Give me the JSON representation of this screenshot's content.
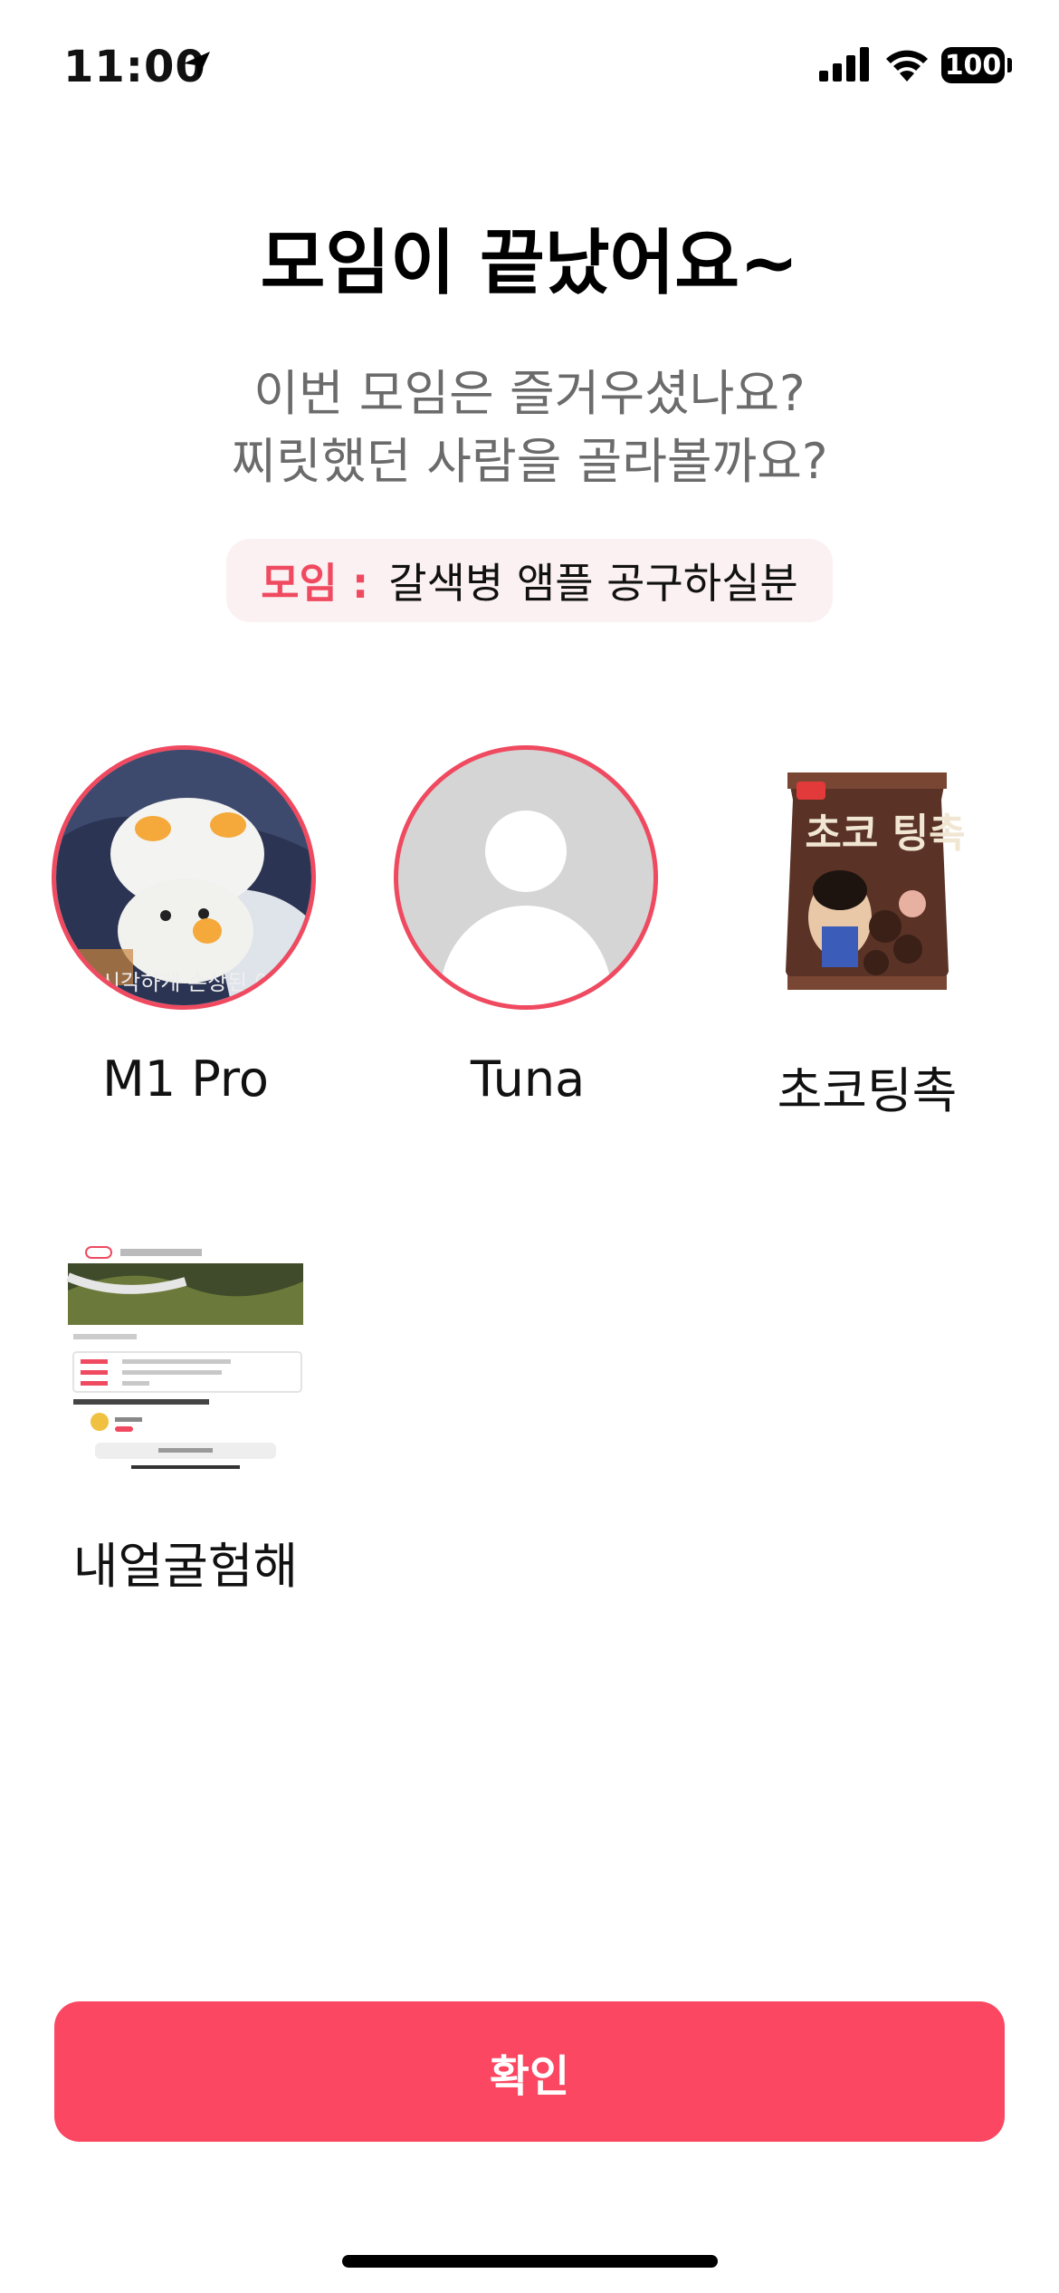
{
  "status_bar": {
    "time": "11:00",
    "battery": "100"
  },
  "title": "모임이 끝났어요~",
  "subtitle": [
    "이번 모임은 즐거우셨나요?",
    "찌릿했던 사람을 골라볼까요?"
  ],
  "meeting": {
    "label": "모임 :",
    "name": "갈색병 앰플 공구하실분"
  },
  "members": [
    {
      "name": "M1 Pro",
      "avatar": "plush-toy-photo",
      "selected": true,
      "avatar_caption": "시각하게 손상된 이"
    },
    {
      "name": "Tuna",
      "avatar": "default-person-icon",
      "selected": true
    },
    {
      "name": "초코팅촉",
      "avatar": "snack-bag-photo",
      "selected": false,
      "brand_text": "초코 팅촉"
    },
    {
      "name": "내얼굴험해",
      "avatar": "app-screenshot-photo",
      "selected": false
    }
  ],
  "confirm_label": "확인",
  "colors": {
    "accent": "#fb4761",
    "ring": "#ef4a60",
    "pill_bg": "#fbf1f2",
    "subtitle": "#6b6b6b"
  }
}
